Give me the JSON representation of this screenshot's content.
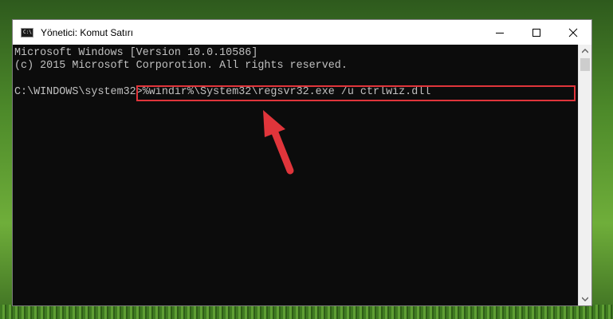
{
  "window": {
    "title": "Yönetici: Komut Satırı",
    "icon": "cmd-icon",
    "icon_text": "C:\\"
  },
  "controls": {
    "minimize_icon": "minimize-icon",
    "maximize_icon": "maximize-icon",
    "close_icon": "close-icon"
  },
  "console": {
    "lines": [
      "Microsoft Windows [Version 10.0.10586]",
      "(c) 2015 Microsoft Corporotion. All rights reserved."
    ],
    "prompt": "C:\\WINDOWS\\system32>",
    "command": "%windir%\\System32\\regsvr32.exe /u ctrlwiz.dll",
    "text_color": "#c0c0c0",
    "background": "#0c0c0c"
  },
  "annotation": {
    "highlight_color": "#e0353b",
    "arrow_icon": "red-arrow-icon"
  }
}
